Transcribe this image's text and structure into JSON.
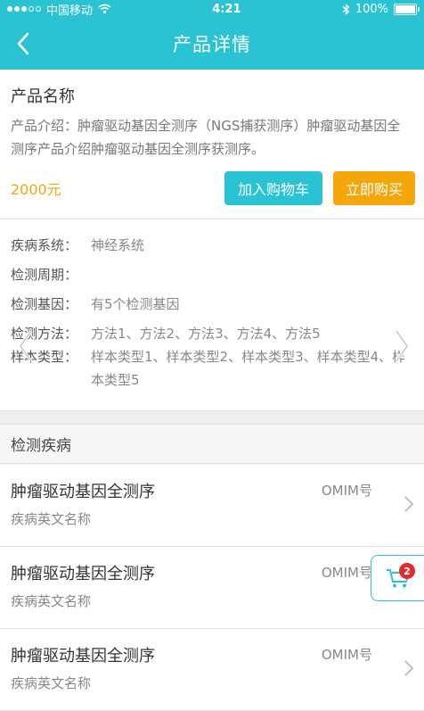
{
  "status_bar": {
    "carrier": "中国移动",
    "time": "4:21",
    "battery": "100%",
    "signal_level": 3,
    "signal_max": 5
  },
  "nav": {
    "title": "产品详情"
  },
  "product": {
    "name": "产品名称",
    "description": "产品介绍：肿瘤驱动基因全测序（NGS捕获测序）肿瘤驱动基因全测序产品介绍肿瘤驱动基因全测序获测序。",
    "price": "2000元",
    "add_to_cart_label": "加入购物车",
    "buy_now_label": "立即购买"
  },
  "attributes": [
    {
      "label": "疾病系统：",
      "value": "神经系统"
    },
    {
      "label": "检测周期：",
      "value": ""
    },
    {
      "label": "检测基因：",
      "value": "有5个检测基因"
    },
    {
      "label": "检测方法：",
      "value": "方法1、方法2、方法3、方法4、方法5"
    },
    {
      "label": "样本类型：",
      "value": "样本类型1、样本类型2、样本类型3、样本类型4、样本类型5"
    }
  ],
  "section": {
    "title": "检测疾病"
  },
  "diseases": [
    {
      "name": "肿瘤驱动基因全测序",
      "english_name": "疾病英文名称",
      "omim": "OMIM号"
    },
    {
      "name": "肿瘤驱动基因全测序",
      "english_name": "疾病英文名称",
      "omim": "OMIM号"
    },
    {
      "name": "肿瘤驱动基因全测序",
      "english_name": "疾病英文名称",
      "omim": "OMIM号"
    }
  ],
  "cart": {
    "count": "2"
  },
  "colors": {
    "primary": "#29c3d4",
    "accent": "#f5a60a",
    "badge": "#e02c2c"
  }
}
